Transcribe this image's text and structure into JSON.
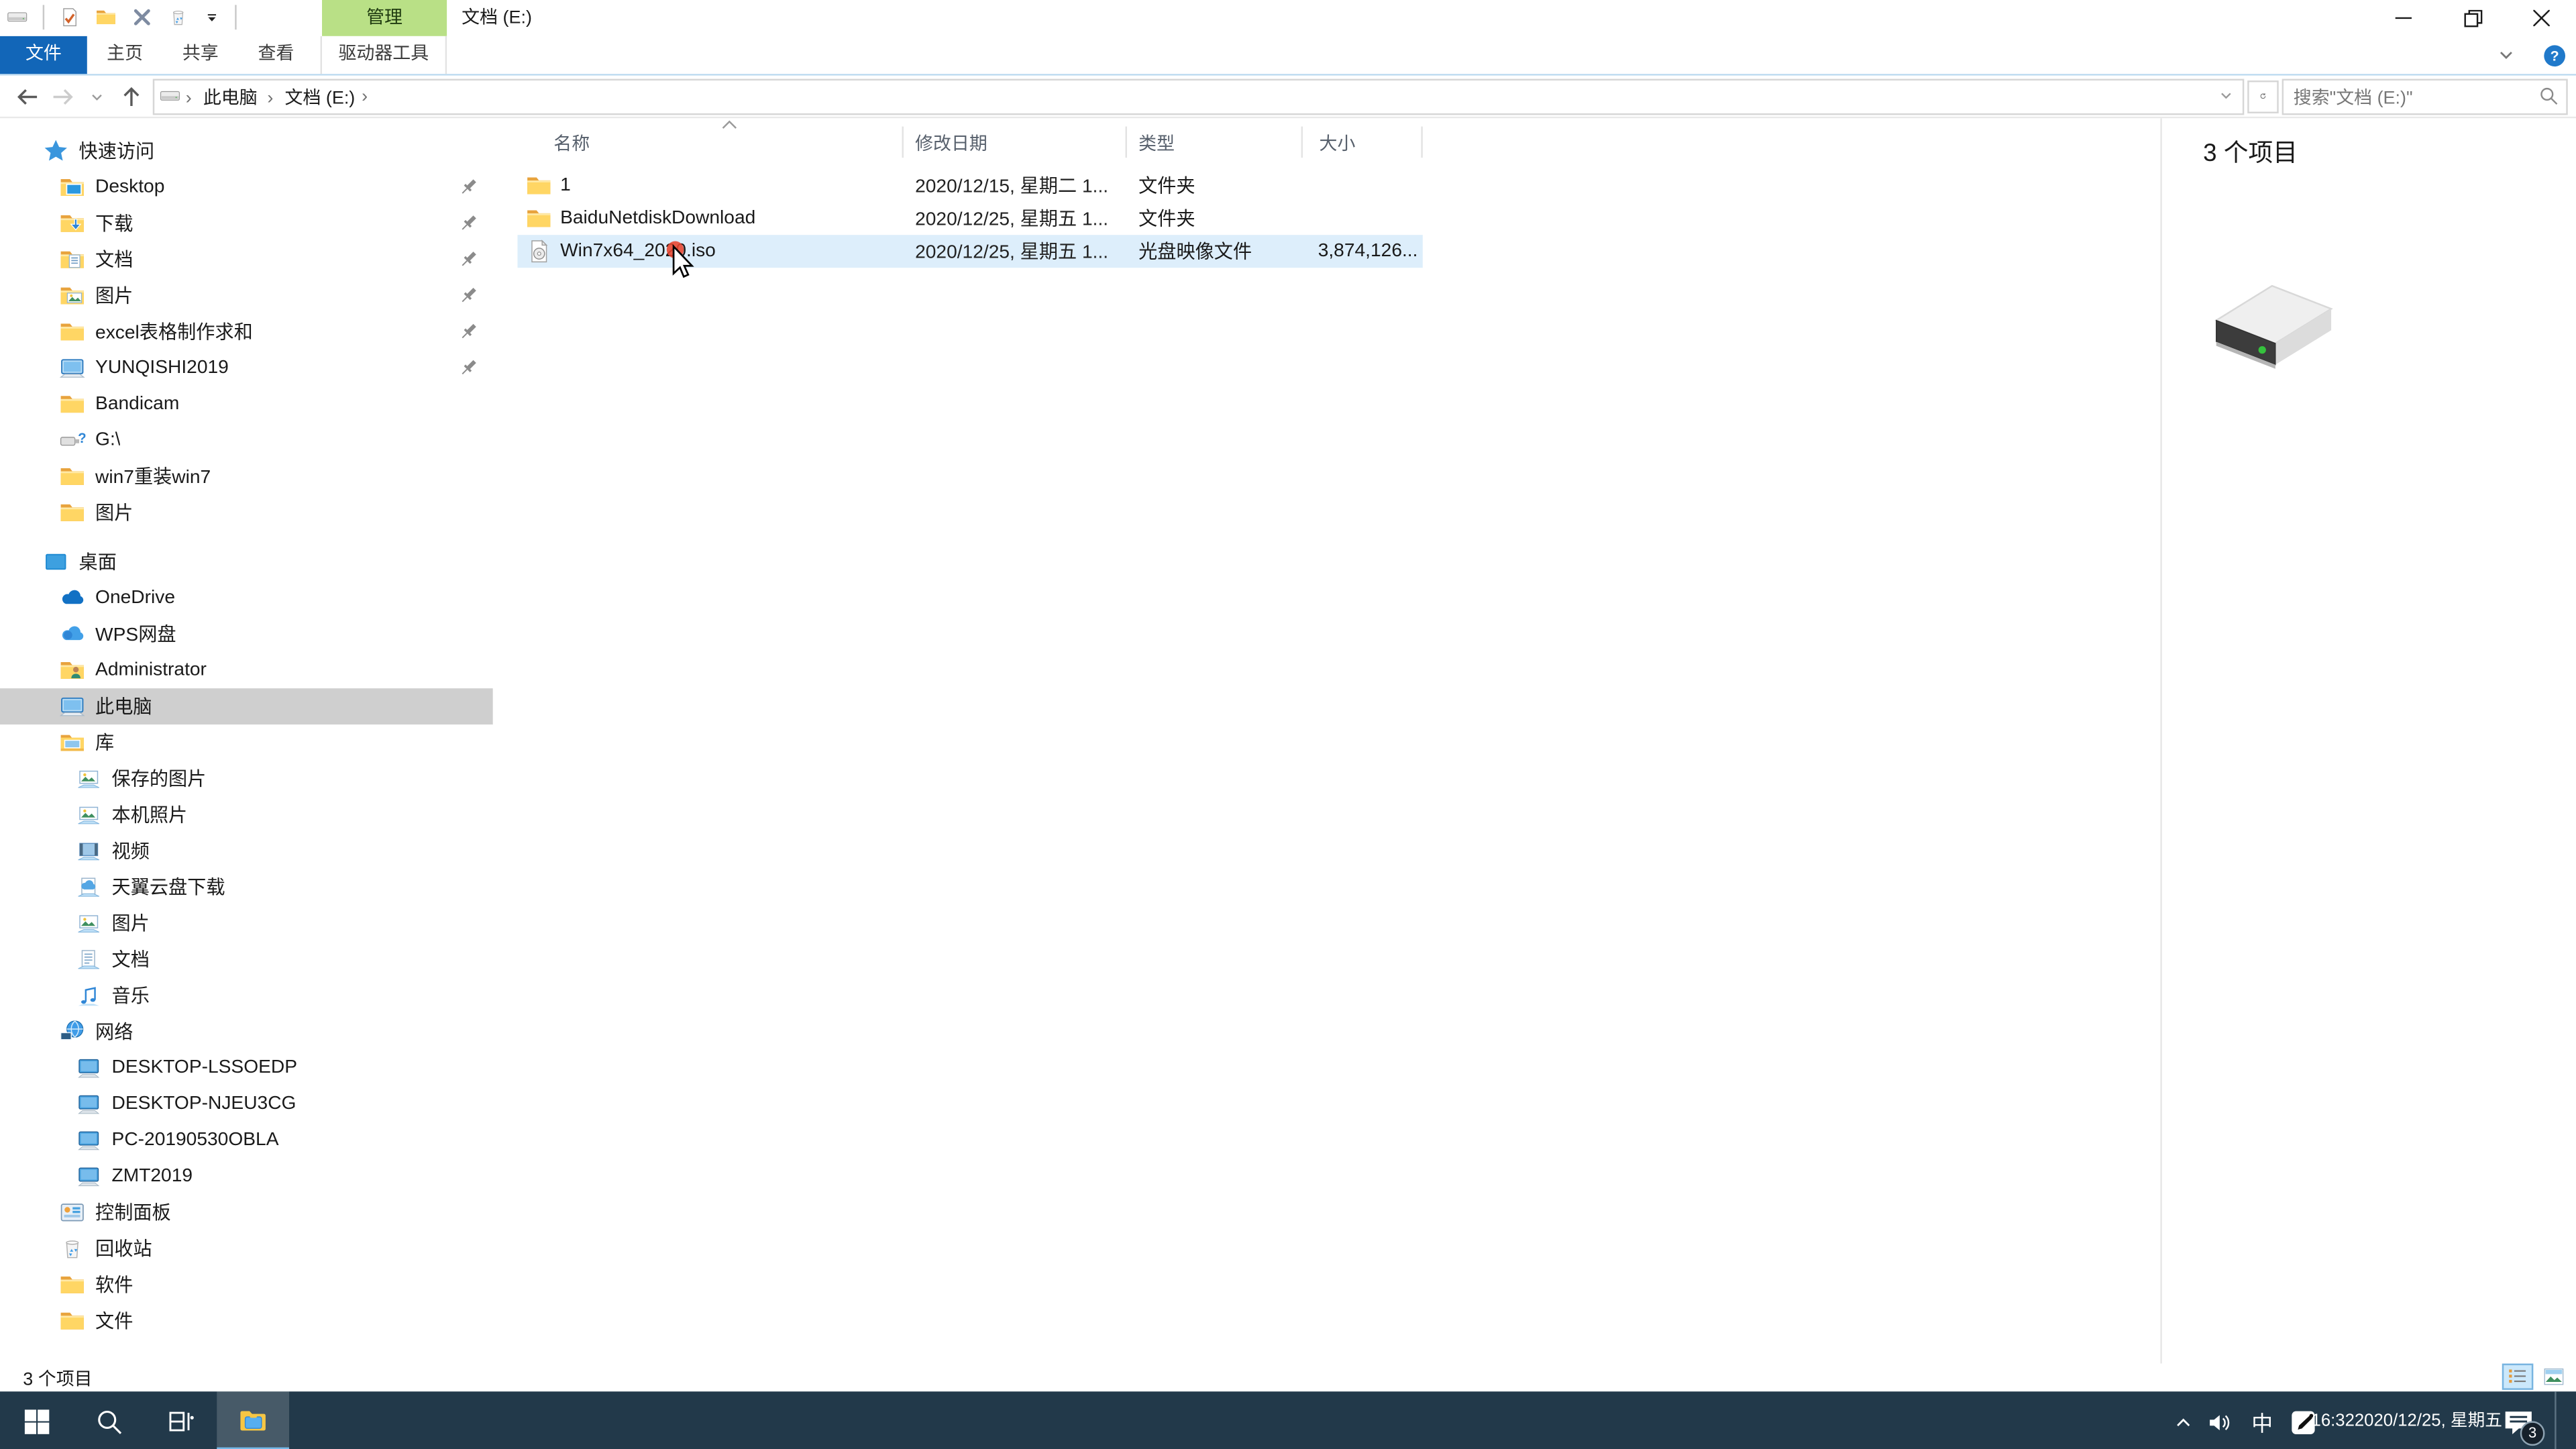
{
  "colors": {
    "accent_blue": "#1266b8",
    "contextual_green": "#b9e086",
    "taskbar_bg": "#22394a",
    "selection_blue": "#ddeefb",
    "sidebar_selected_gray": "#cfcfcf"
  },
  "titlebar": {
    "title": "文档 (E:)",
    "contextual_group": "管理",
    "qat_icons": [
      "drive-icon",
      "properties-check-icon",
      "new-folder-icon",
      "delete-x-icon",
      "recycle-bin-icon",
      "dropdown-icon"
    ],
    "window_controls": [
      "minimize-icon",
      "restore-icon",
      "close-icon"
    ]
  },
  "ribbon": {
    "file_tab": "文件",
    "tabs": [
      "主页",
      "共享",
      "查看"
    ],
    "contextual_tab": "驱动器工具",
    "help_glyph": "?"
  },
  "addressbar": {
    "crumbs": [
      "此电脑",
      "文档 (E:)"
    ],
    "search_placeholder": "搜索\"文档 (E:)\""
  },
  "sidebar": {
    "items": [
      {
        "label": "快速访问",
        "icon": "star",
        "level": 0
      },
      {
        "label": "Desktop",
        "icon": "folder-desktop",
        "level": 1,
        "pinned": true
      },
      {
        "label": "下载",
        "icon": "folder-download",
        "level": 1,
        "pinned": true
      },
      {
        "label": "文档",
        "icon": "folder-doc",
        "level": 1,
        "pinned": true
      },
      {
        "label": "图片",
        "icon": "folder-pic",
        "level": 1,
        "pinned": true
      },
      {
        "label": "excel表格制作求和",
        "icon": "folder",
        "level": 1,
        "pinned": true
      },
      {
        "label": "YUNQISHI2019",
        "icon": "computer",
        "level": 1,
        "pinned": true
      },
      {
        "label": "Bandicam",
        "icon": "folder",
        "level": 1
      },
      {
        "label": "G:\\",
        "icon": "usb",
        "level": 1
      },
      {
        "label": "win7重装win7",
        "icon": "folder",
        "level": 1
      },
      {
        "label": "图片",
        "icon": "folder",
        "level": 1
      },
      {
        "label": "桌面",
        "icon": "desktop",
        "level": 0,
        "gap": true
      },
      {
        "label": "OneDrive",
        "icon": "cloud-dark",
        "level": 1
      },
      {
        "label": "WPS网盘",
        "icon": "cloud-blue",
        "level": 1
      },
      {
        "label": "Administrator",
        "icon": "user-folder",
        "level": 1
      },
      {
        "label": "此电脑",
        "icon": "computer",
        "level": 1,
        "selected": true
      },
      {
        "label": "库",
        "icon": "library",
        "level": 1
      },
      {
        "label": "保存的图片",
        "icon": "lib-pic",
        "level": 2
      },
      {
        "label": "本机照片",
        "icon": "lib-pic",
        "level": 2
      },
      {
        "label": "视频",
        "icon": "lib-video",
        "level": 2
      },
      {
        "label": "天翼云盘下载",
        "icon": "lib-cloud",
        "level": 2
      },
      {
        "label": "图片",
        "icon": "lib-pic",
        "level": 2
      },
      {
        "label": "文档",
        "icon": "lib-doc",
        "level": 2
      },
      {
        "label": "音乐",
        "icon": "lib-music",
        "level": 2
      },
      {
        "label": "网络",
        "icon": "network",
        "level": 1
      },
      {
        "label": "DESKTOP-LSSOEDP",
        "icon": "net-pc",
        "level": 2
      },
      {
        "label": "DESKTOP-NJEU3CG",
        "icon": "net-pc",
        "level": 2
      },
      {
        "label": "PC-20190530OBLA",
        "icon": "net-pc",
        "level": 2
      },
      {
        "label": "ZMT2019",
        "icon": "net-pc",
        "level": 2
      },
      {
        "label": "控制面板",
        "icon": "control-panel",
        "level": 1
      },
      {
        "label": "回收站",
        "icon": "recycle",
        "level": 1
      },
      {
        "label": "软件",
        "icon": "folder",
        "level": 1
      },
      {
        "label": "文件",
        "icon": "folder",
        "level": 1
      }
    ]
  },
  "files": {
    "columns": [
      "名称",
      "修改日期",
      "类型",
      "大小"
    ],
    "rows": [
      {
        "name": "1",
        "icon": "folder",
        "date": "2020/12/15, 星期二 1...",
        "type": "文件夹",
        "size": ""
      },
      {
        "name": "BaiduNetdiskDownload",
        "icon": "folder",
        "date": "2020/12/25, 星期五 1...",
        "type": "文件夹",
        "size": ""
      },
      {
        "name": "Win7x64_2020.iso",
        "icon": "iso",
        "date": "2020/12/25, 星期五 1...",
        "type": "光盘映像文件",
        "size": "3,874,126...",
        "selected": true
      }
    ]
  },
  "preview": {
    "count_label": "3 个项目"
  },
  "statusbar": {
    "count_label": "3 个项目"
  },
  "taskbar": {
    "ime_label": "中",
    "time": "16:32",
    "date": "2020/12/25, 星期五",
    "notification_count": "3"
  }
}
